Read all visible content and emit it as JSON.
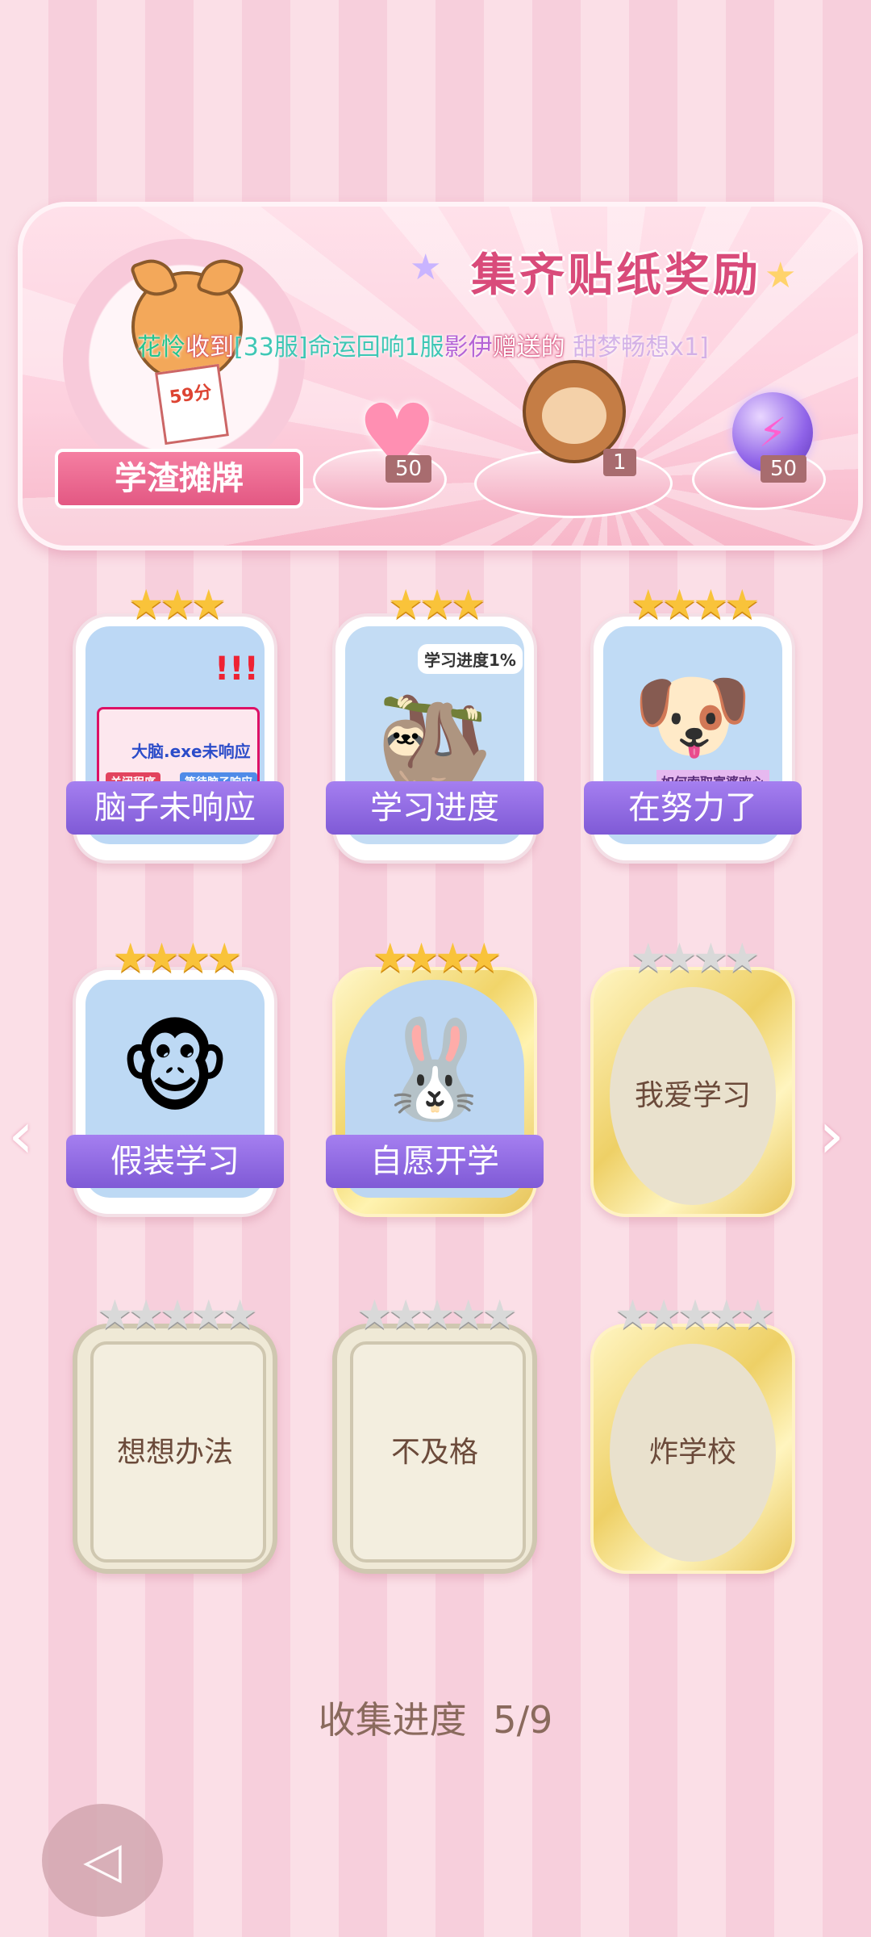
{
  "banner": {
    "title": "集齐贴纸奖励",
    "badge_label": "学渣摊牌",
    "paper_score": "59分",
    "rewards": [
      {
        "icon": "heart-gem-icon",
        "count": "50"
      },
      {
        "icon": "monkey-sticker-icon",
        "count": "1"
      },
      {
        "icon": "purple-orb-icon",
        "count": "50"
      }
    ]
  },
  "ticker": {
    "sender": "花怜",
    "verb": "收到",
    "server": "[33服]命运回响1服",
    "player": "影伊",
    "suffix": "赠送的",
    "ghost": "甜梦畅想x1]"
  },
  "stickers": [
    {
      "name": "脑子未响应",
      "stars": "★★★",
      "state": "unlocked",
      "art_text_1": "大脑.exe未响应",
      "art_text_2": "关闭程序",
      "art_text_3": "等待脑子响应"
    },
    {
      "name": "学习进度",
      "stars": "★★★",
      "state": "unlocked",
      "art_text_1": "学习进度1%"
    },
    {
      "name": "在努力了",
      "stars": "★★★★",
      "state": "unlocked",
      "art_text_1": "如何索取富婆欢心"
    },
    {
      "name": "假装学习",
      "stars": "★★★★",
      "state": "unlocked"
    },
    {
      "name": "自愿开学",
      "stars": "★★★★",
      "state": "unlocked"
    },
    {
      "name": "我爱学习",
      "stars": "★★★★",
      "state": "locked"
    },
    {
      "name": "想想办法",
      "stars": "★★★★★",
      "state": "locked"
    },
    {
      "name": "不及格",
      "stars": "★★★★★",
      "state": "locked"
    },
    {
      "name": "炸学校",
      "stars": "★★★★★",
      "state": "locked"
    }
  ],
  "progress": {
    "label": "收集进度",
    "value": "5/9"
  },
  "colors": {
    "accent": "#d94b7a",
    "label_purple": "#8b64dd",
    "star_gold": "#f9c33a"
  }
}
